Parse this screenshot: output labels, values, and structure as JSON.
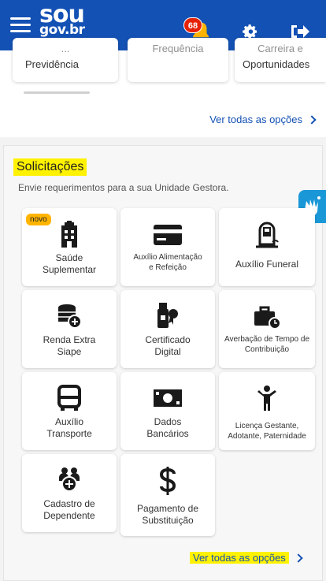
{
  "header": {
    "logo_top": "sou",
    "logo_bottom": "gov.br",
    "notification_count": "68"
  },
  "top_cards": [
    {
      "partial": "...",
      "label": "Previdência"
    },
    {
      "partial": "Frequência",
      "label": ""
    },
    {
      "partial": "Carreira e",
      "label": "Oportunidades"
    }
  ],
  "top_link": "Ver todas as opções",
  "solicitacoes": {
    "title": "Solicitações",
    "subtitle": "Envie requerimentos para a sua Unidade Gestora.",
    "badge_new": "novo",
    "items": [
      {
        "line1": "Saúde",
        "line2": "Suplementar",
        "icon": "hospital-icon"
      },
      {
        "line1": "Auxílio Alimentação",
        "line2": "e Refeição",
        "icon": "credit-card-icon"
      },
      {
        "line1": "Auxílio Funeral",
        "line2": "",
        "icon": "tombstone-icon"
      },
      {
        "line1": "Renda Extra",
        "line2": "Siape",
        "icon": "coins-icon"
      },
      {
        "line1": "Certificado",
        "line2": "Digital",
        "icon": "usb-certificate-icon"
      },
      {
        "line1": "Averbação de Tempo de",
        "line2": "Contribuição",
        "icon": "briefcase-clock-icon"
      },
      {
        "line1": "Auxílio",
        "line2": "Transporte",
        "icon": "bus-icon"
      },
      {
        "line1": "Dados",
        "line2": "Bancários",
        "icon": "money-icon"
      },
      {
        "line1": "Licença Gestante,",
        "line2": "Adotante, Paternidade",
        "icon": "child-icon"
      },
      {
        "line1": "Cadastro de",
        "line2": "Dependente",
        "icon": "add-family-icon"
      },
      {
        "line1": "Pagamento de",
        "line2": "Substituição",
        "icon": "dollar-icon"
      }
    ],
    "bottom_link": "Ver todas as opções"
  },
  "colors": {
    "primary": "#1351b4",
    "highlight": "#fff200",
    "badge": "#e52207",
    "novo": "#ffb400"
  }
}
